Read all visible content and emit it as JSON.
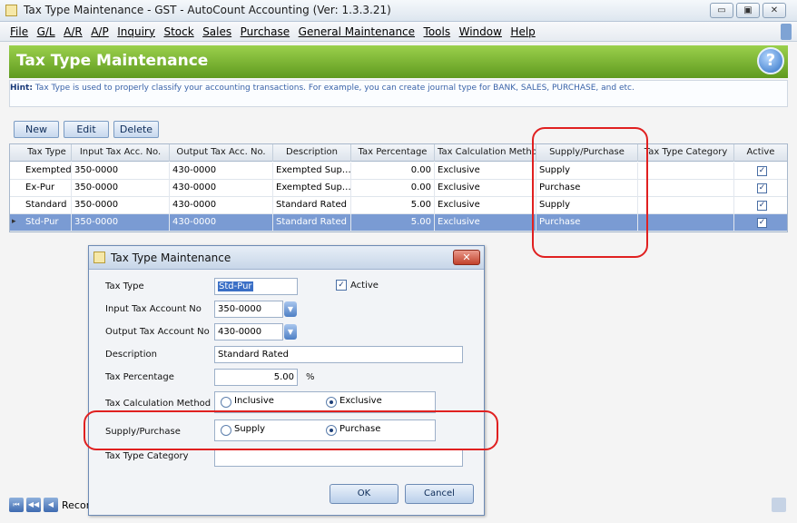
{
  "window": {
    "title": "Tax Type Maintenance - GST - AutoCount Accounting (Ver: 1.3.3.21)",
    "minimize": "▭",
    "restore": "▣",
    "close": "✕"
  },
  "menu": {
    "items": [
      "File",
      "G/L",
      "A/R",
      "A/P",
      "Inquiry",
      "Stock",
      "Sales",
      "Purchase",
      "General Maintenance",
      "Tools",
      "Window",
      "Help"
    ]
  },
  "header": {
    "title": "Tax Type Maintenance",
    "help_icon": "?"
  },
  "hint": {
    "prefix": "Hint:",
    "text": " Tax Type is used to properly classify your accounting transactions. For example, you can create journal type for BANK, SALES, PURCHASE, and etc."
  },
  "toolbar": {
    "new_label": "New",
    "edit_label": "Edit",
    "delete_label": "Delete"
  },
  "grid": {
    "columns": [
      "Tax Type",
      "Input Tax Acc. No.",
      "Output Tax Acc. No.",
      "Description",
      "Tax Percentage",
      "Tax Calculation Method",
      "Supply/Purchase",
      "Tax Type Category",
      "Active"
    ],
    "rows": [
      {
        "tax_type": "Exempted",
        "input_acc": "350-0000",
        "output_acc": "430-0000",
        "description": "Exempted Sup…",
        "percentage": "0.00",
        "method": "Exclusive",
        "supply_purchase": "Supply",
        "category": "",
        "active": true
      },
      {
        "tax_type": "Ex-Pur",
        "input_acc": "350-0000",
        "output_acc": "430-0000",
        "description": "Exempted Sup…",
        "percentage": "0.00",
        "method": "Exclusive",
        "supply_purchase": "Purchase",
        "category": "",
        "active": true
      },
      {
        "tax_type": "Standard",
        "input_acc": "350-0000",
        "output_acc": "430-0000",
        "description": "Standard Rated",
        "percentage": "5.00",
        "method": "Exclusive",
        "supply_purchase": "Supply",
        "category": "",
        "active": true
      },
      {
        "tax_type": "Std-Pur",
        "input_acc": "350-0000",
        "output_acc": "430-0000",
        "description": "Standard Rated",
        "percentage": "5.00",
        "method": "Exclusive",
        "supply_purchase": "Purchase",
        "category": "",
        "active": true,
        "selected": true
      }
    ],
    "checkmark": "✓",
    "row_indicator": "▸"
  },
  "navigator": {
    "first": "⏮",
    "prev_page": "◀◀",
    "prev": "◀",
    "label": "Recor"
  },
  "dialog": {
    "title": "Tax Type Maintenance",
    "close": "✕",
    "tax_type_label": "Tax Type",
    "tax_type_value": "Std-Pur",
    "active_label": "Active",
    "active_checked": true,
    "input_acc_label": "Input Tax Account No",
    "input_acc_value": "350-0000",
    "output_acc_label": "Output Tax Account No",
    "output_acc_value": "430-0000",
    "description_label": "Description",
    "description_value": "Standard Rated",
    "percentage_label": "Tax Percentage",
    "percentage_value": "5.00",
    "percentage_unit": "%",
    "method_label": "Tax Calculation Method",
    "method_options": [
      "Inclusive",
      "Exclusive"
    ],
    "method_selected": "Exclusive",
    "supply_purchase_label": "Supply/Purchase",
    "supply_purchase_options": [
      "Supply",
      "Purchase"
    ],
    "supply_purchase_selected": "Purchase",
    "category_label": "Tax Type Category",
    "category_value": "",
    "ok_label": "OK",
    "cancel_label": "Cancel",
    "dropdown_glyph": "▼",
    "checkmark": "✓"
  },
  "colors": {
    "header_green": "#6fa82a",
    "selection_blue": "#7a9bd3",
    "highlight_red": "#e02020"
  }
}
